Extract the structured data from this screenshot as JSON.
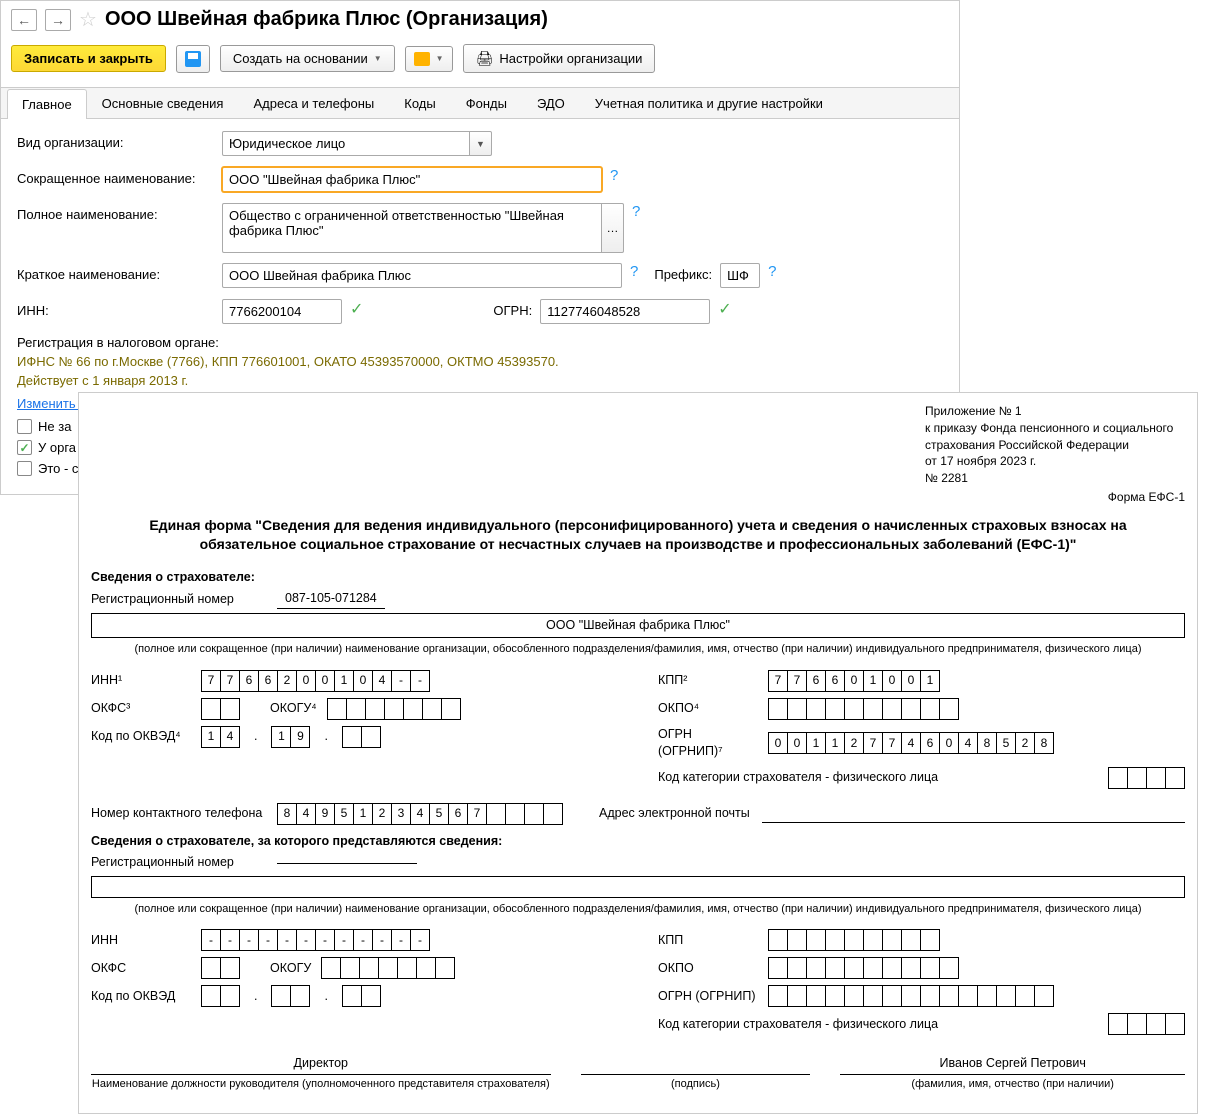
{
  "header": {
    "title": "ООО Швейная фабрика Плюс (Организация)"
  },
  "toolbar": {
    "save_close": "Записать и закрыть",
    "create_based": "Создать на основании",
    "org_settings": "Настройки организации"
  },
  "tabs": [
    "Главное",
    "Основные сведения",
    "Адреса и телефоны",
    "Коды",
    "Фонды",
    "ЭДО",
    "Учетная политика и другие настройки"
  ],
  "form": {
    "org_type_label": "Вид организации:",
    "org_type_value": "Юридическое лицо",
    "short_name_label": "Сокращенное наименование:",
    "short_name_value": "ООО \"Швейная фабрика Плюс\"",
    "full_name_label": "Полное наименование:",
    "full_name_value": "Общество с ограниченной ответственностью \"Швейная фабрика Плюс\"",
    "brief_name_label": "Краткое наименование:",
    "brief_name_value": "ООО Швейная фабрика Плюс",
    "prefix_label": "Префикс:",
    "prefix_value": "ШФ",
    "inn_label": "ИНН:",
    "inn_value": "7766200104",
    "ogrn_label": "ОГРН:",
    "ogrn_value": "1127746048528",
    "tax_reg_header": "Регистрация в налоговом органе:",
    "tax_info1": "ИФНС № 66 по г.Москве (7766), КПП 776601001, ОКАТО 45393570000, ОКТМО 45393570.",
    "tax_info2": "Действует с 1 января 2013 г.",
    "change_reg": "Изменить данные регистрации",
    "cb1": "Не за",
    "cb2": "У орга",
    "cb3": "Это - с"
  },
  "doc": {
    "appendix": "Приложение № 1\nк приказу Фонда пенсионного и социального\nстрахования Российской Федерации\nот 17 ноября 2023 г.\n№ 2281",
    "form_code": "Форма ЕФС-1",
    "title": "Единая форма \"Сведения для ведения индивидуального (персонифицированного) учета и сведения о начисленных страховых взносах на обязательное социальное страхование от несчастных случаев на производстве и профессиональных заболеваний (ЕФС-1)\"",
    "section1": "Сведения о страхователе:",
    "reg_num_label": "Регистрационный номер",
    "reg_num": "087-105-071284",
    "org_name": "ООО \"Швейная фабрика Плюс\"",
    "name_note": "(полное или сокращенное (при наличии) наименование организации, обособленного подразделения/фамилия, имя, отчество (при наличии) индивидуального предпринимателя, физического лица)",
    "inn_label": "ИНН¹",
    "inn_boxes": [
      "7",
      "7",
      "6",
      "6",
      "2",
      "0",
      "0",
      "1",
      "0",
      "4",
      "-",
      "-"
    ],
    "kpp_label": "КПП²",
    "kpp_boxes": [
      "7",
      "7",
      "6",
      "6",
      "0",
      "1",
      "0",
      "0",
      "1"
    ],
    "okfs_label": "ОКФС³",
    "okogu_label": "ОКОГУ⁴",
    "okpo_label": "ОКПО⁴",
    "okved_label": "Код по ОКВЭД⁴",
    "okved1": [
      "1",
      "4"
    ],
    "okved2": [
      "1",
      "9"
    ],
    "ogrn_label": "ОГРН (ОГРНИП)⁷",
    "ogrn_boxes": [
      "0",
      "0",
      "1",
      "1",
      "2",
      "7",
      "7",
      "4",
      "6",
      "0",
      "4",
      "8",
      "5",
      "2",
      "8"
    ],
    "cat_label": "Код категории страхователя - физического лица",
    "phone_label": "Номер контактного телефона",
    "phone_boxes": [
      "8",
      "4",
      "9",
      "5",
      "1",
      "2",
      "3",
      "4",
      "5",
      "6",
      "7",
      "",
      "",
      "",
      ""
    ],
    "email_label": "Адрес электронной почты",
    "section2": "Сведения о страхователе, за которого представляются сведения:",
    "inn2_label": "ИНН",
    "inn2_boxes": [
      "-",
      "-",
      "-",
      "-",
      "-",
      "-",
      "-",
      "-",
      "-",
      "-",
      "-",
      "-"
    ],
    "kpp2_label": "КПП",
    "okfs2_label": "ОКФС",
    "okogu2_label": "ОКОГУ",
    "okpo2_label": "ОКПО",
    "okved2_label": "Код по ОКВЭД",
    "ogrn2_label": "ОГРН (ОГРНИП)",
    "director": "Директор",
    "director_name": "Иванов Сергей Петрович",
    "sig_cap1": "Наименование должности руководителя (уполномоченного представителя страхователя)",
    "sig_cap2": "(подпись)",
    "sig_cap3": "(фамилия, имя, отчество (при наличии)"
  }
}
